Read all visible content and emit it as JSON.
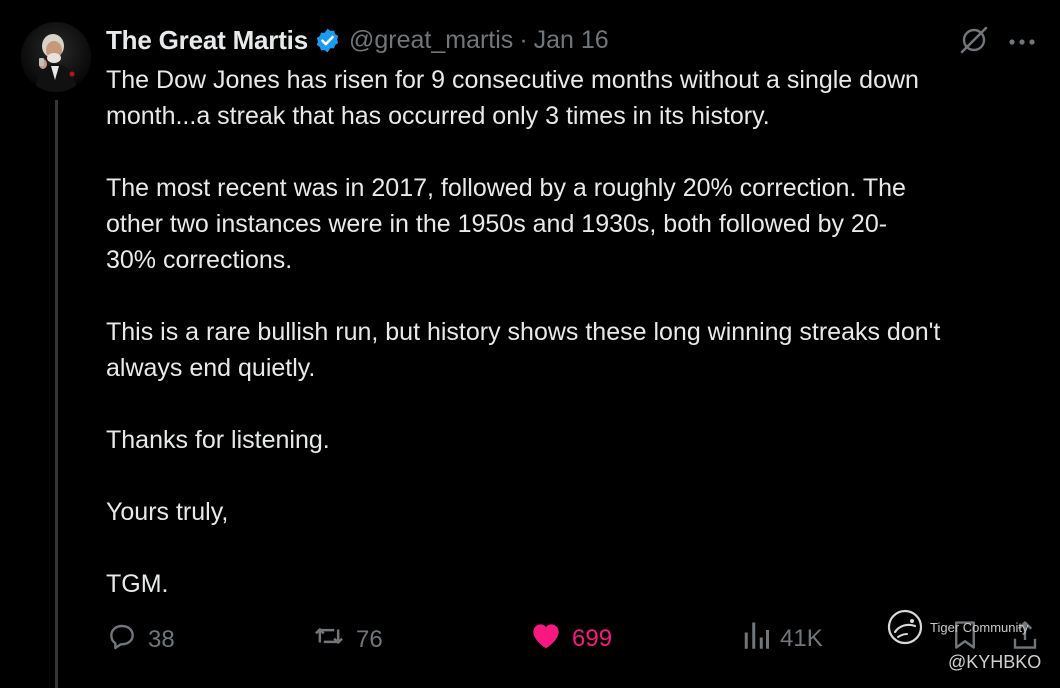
{
  "author": {
    "display_name": "The Great Martis",
    "handle": "@great_martis",
    "separator": "·",
    "date": "Jan 16",
    "avatar_icon": "portrait-avatar",
    "verified_icon": "verified-badge-icon",
    "verified_color": "#1d9bf0"
  },
  "tweet": {
    "text": "The Dow Jones has risen for 9 consecutive months without a single down\nmonth...a streak that has occurred only 3 times in its history.\n\nThe most recent was in 2017, followed by a roughly 20% correction. The\nother two instances were in the 1950s and 1930s, both followed by 20-\n30% corrections.\n\nThis is a rare bullish run, but history shows these long winning streaks don't\nalways end quietly.\n\nThanks for listening.\n\nYours truly,\n\nTGM."
  },
  "actions": {
    "replies": "38",
    "reposts": "76",
    "likes": "699",
    "views": "41K",
    "like_color": "#f91880"
  },
  "watermark": {
    "brand": "Tiger Community",
    "handle": "@KYHBKO"
  }
}
